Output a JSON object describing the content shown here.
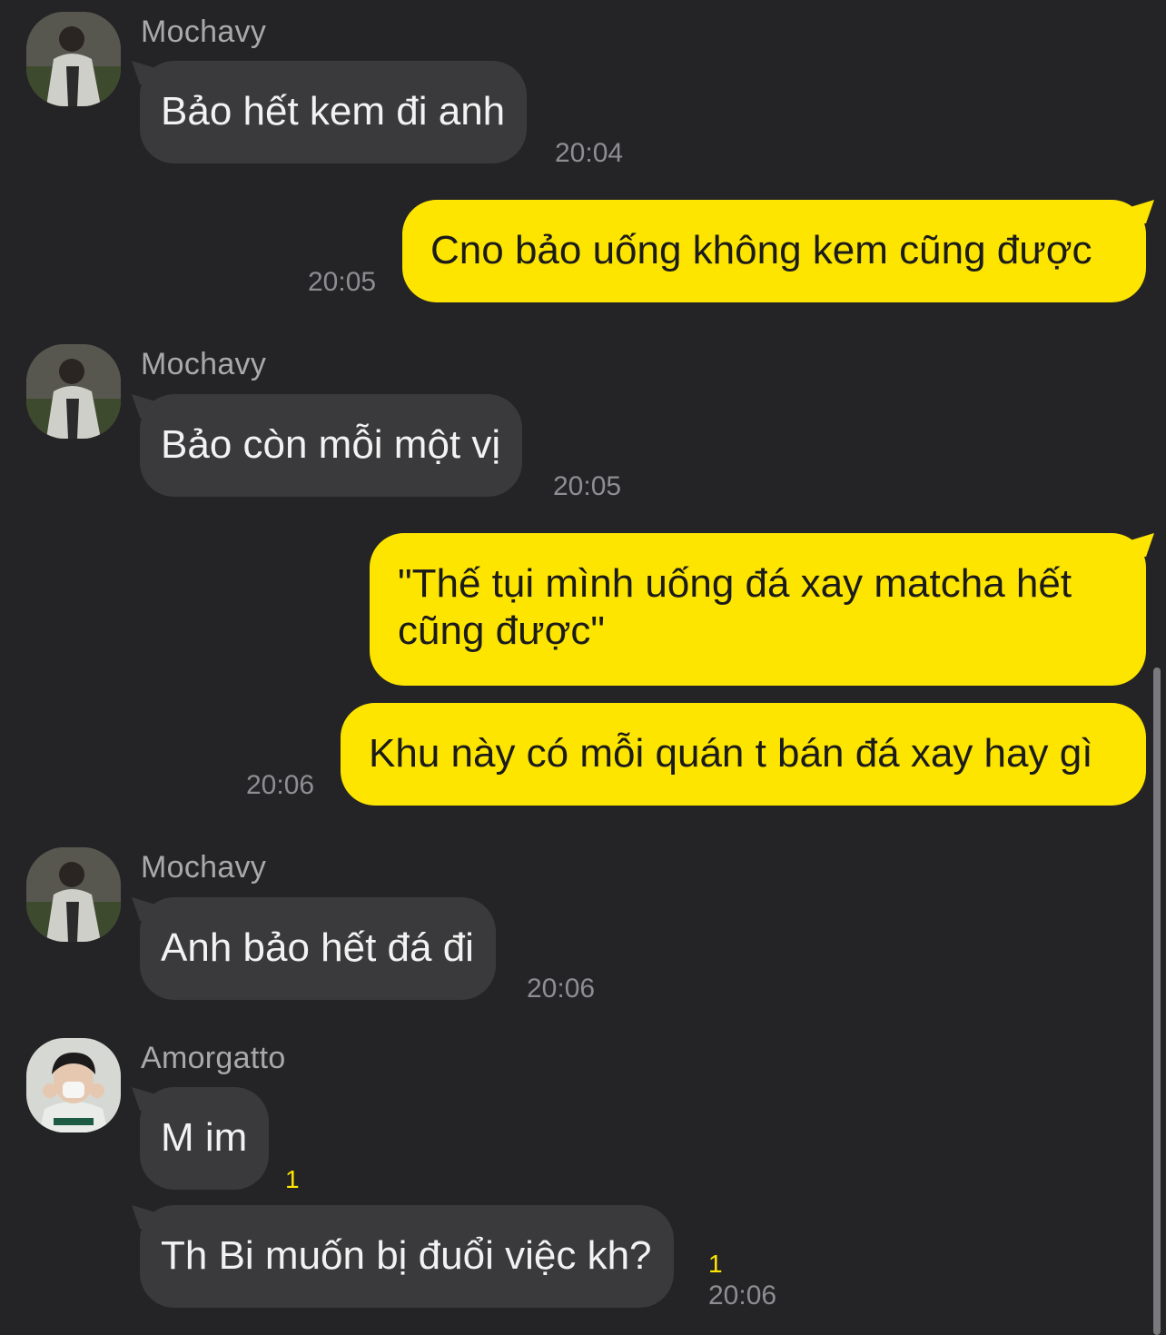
{
  "colors": {
    "background": "#242426",
    "incoming_bubble": "#3a3a3c",
    "outgoing_bubble": "#fee500",
    "unread": "#fee500"
  },
  "messages": [
    {
      "sender": "Mochavy",
      "text": "Bảo hết kem đi anh",
      "time": "20:04"
    },
    {
      "text": "Cno bảo uống không kem cũng được",
      "time": "20:05"
    },
    {
      "sender": "Mochavy",
      "text": "Bảo còn mỗi một vị",
      "time": "20:05"
    },
    {
      "line1": "\"Thế tụi mình uống đá xay matcha hết",
      "line2": "cũng được\""
    },
    {
      "text": "Khu này có mỗi quán t bán đá xay hay gì",
      "time": "20:06"
    },
    {
      "sender": "Mochavy",
      "text": "Anh bảo hết đá đi",
      "time": "20:06"
    },
    {
      "sender": "Amorgatto",
      "text": "M im",
      "unread": "1"
    },
    {
      "text": "Th Bi muốn bị đuổi việc kh?",
      "unread": "1",
      "time": "20:06"
    }
  ],
  "icons": {
    "avatar_mochavy": "avatar-photo",
    "avatar_amorgatto": "avatar-photo"
  }
}
